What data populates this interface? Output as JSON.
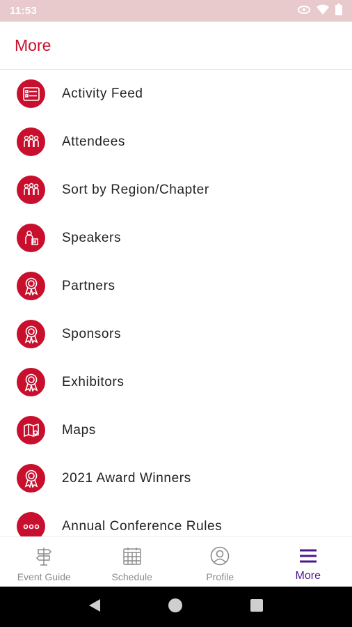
{
  "status_bar": {
    "time": "11:53"
  },
  "header": {
    "title": "More"
  },
  "menu_items": [
    {
      "label": "Activity Feed",
      "icon": "list-icon"
    },
    {
      "label": "Attendees",
      "icon": "group-icon"
    },
    {
      "label": "Sort by Region/Chapter",
      "icon": "group-icon"
    },
    {
      "label": "Speakers",
      "icon": "speaker-icon"
    },
    {
      "label": "Partners",
      "icon": "award-ribbon-icon"
    },
    {
      "label": "Sponsors",
      "icon": "award-ribbon-icon"
    },
    {
      "label": "Exhibitors",
      "icon": "award-ribbon-icon"
    },
    {
      "label": "Maps",
      "icon": "map-icon"
    },
    {
      "label": "2021 Award Winners",
      "icon": "award-ribbon-icon"
    },
    {
      "label": "Annual Conference Rules",
      "icon": "more-dots-icon"
    }
  ],
  "bottom_nav": {
    "tabs": [
      {
        "label": "Event Guide",
        "icon": "signpost-icon",
        "active": false
      },
      {
        "label": "Schedule",
        "icon": "calendar-icon",
        "active": false
      },
      {
        "label": "Profile",
        "icon": "profile-icon",
        "active": false
      },
      {
        "label": "More",
        "icon": "hamburger-menu-icon",
        "active": true
      }
    ]
  },
  "colors": {
    "accent": "#c8102e",
    "active_tab": "#4a1a8c",
    "inactive_tab": "#8a8a8a",
    "status_bar": "#e8c9cc"
  }
}
